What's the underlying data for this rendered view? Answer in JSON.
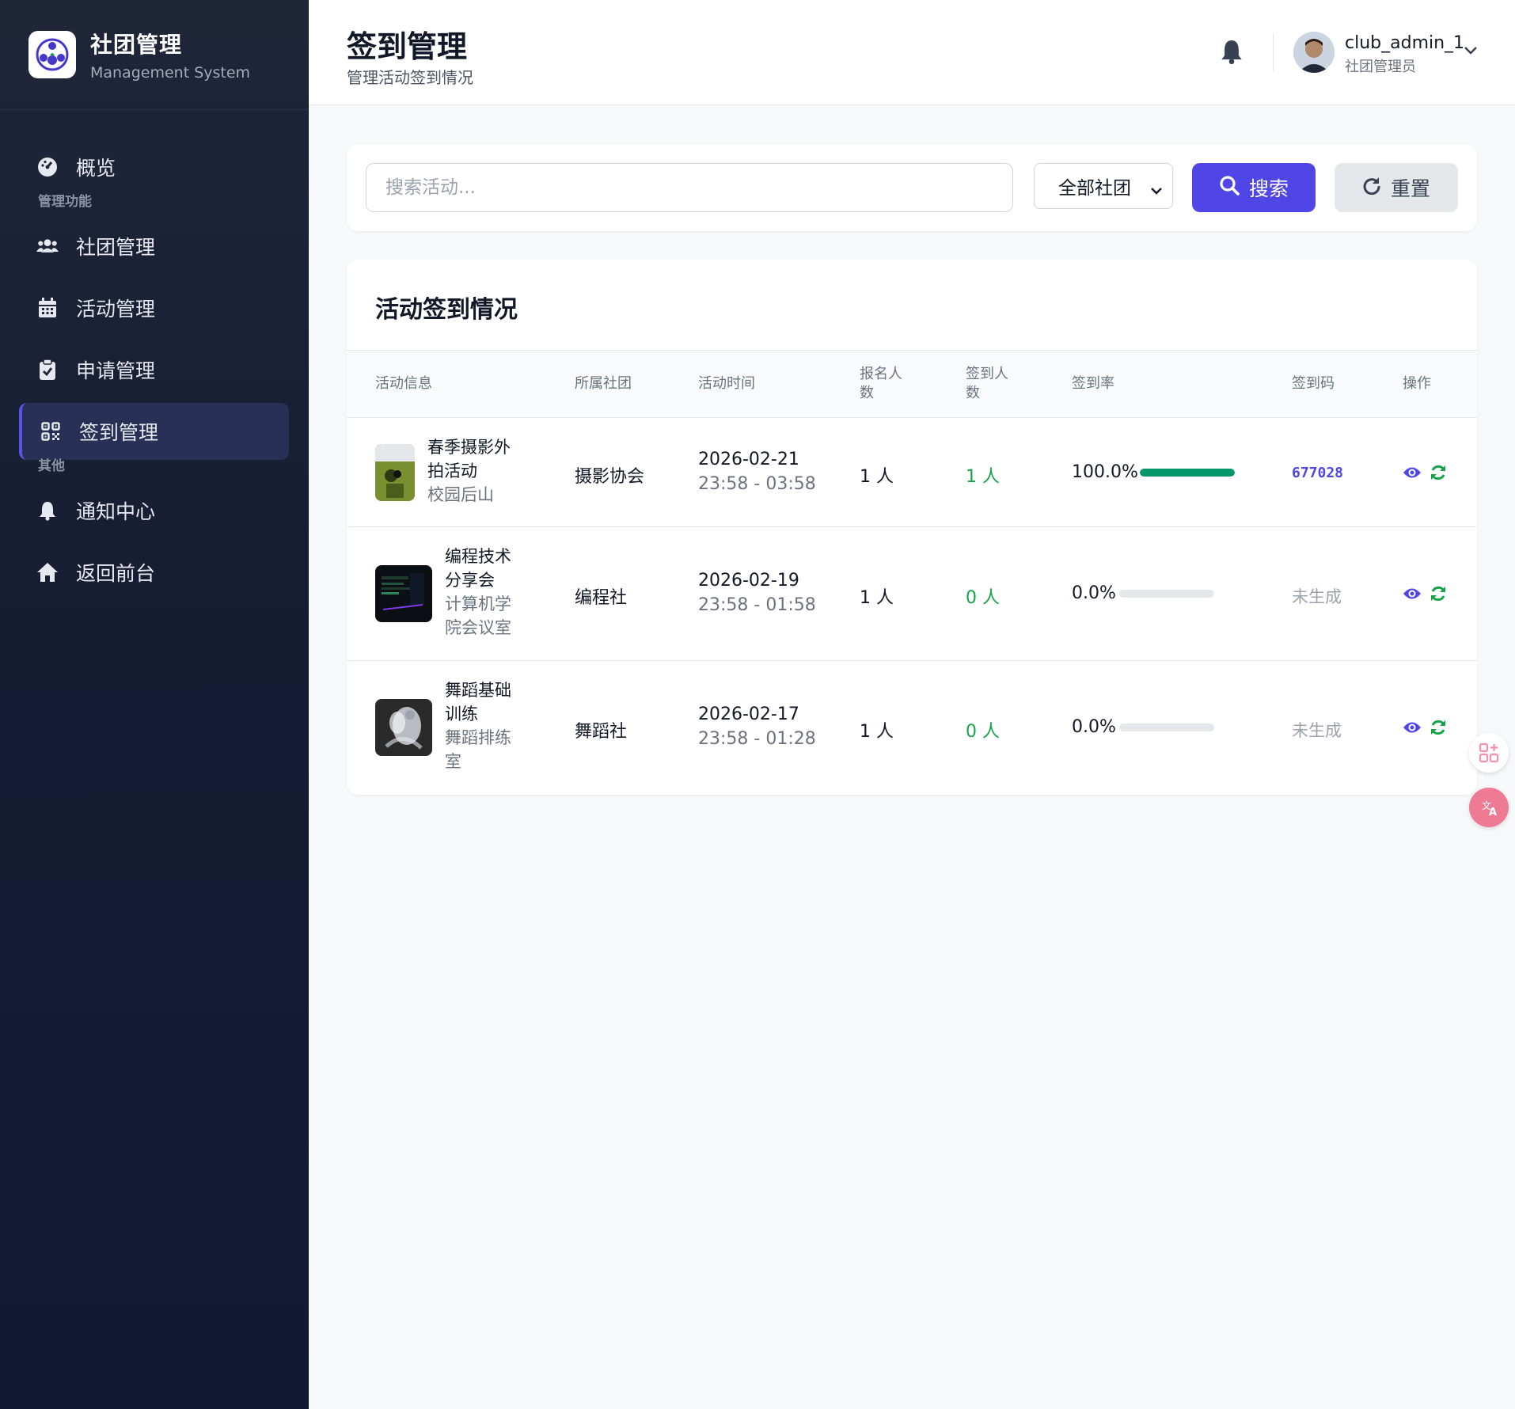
{
  "brand": {
    "title": "社团管理",
    "subtitle": "Management System"
  },
  "sidebar": {
    "overview": "概览",
    "section_manage": "管理功能",
    "items": [
      {
        "label": "社团管理",
        "icon": "users-icon"
      },
      {
        "label": "活动管理",
        "icon": "calendar-icon"
      },
      {
        "label": "申请管理",
        "icon": "clipboard-check-icon"
      },
      {
        "label": "签到管理",
        "icon": "qrcode-icon",
        "active": true
      }
    ],
    "section_other": "其他",
    "other_items": [
      {
        "label": "通知中心",
        "icon": "bell-icon"
      },
      {
        "label": "返回前台",
        "icon": "home-icon"
      }
    ]
  },
  "header": {
    "title": "签到管理",
    "subtitle": "管理活动签到情况",
    "user": {
      "name": "club_admin_1",
      "role": "社团管理员"
    }
  },
  "search": {
    "placeholder": "搜索活动...",
    "value": "",
    "club_filter": "全部社团",
    "search_label": "搜索",
    "reset_label": "重置"
  },
  "table": {
    "title": "活动签到情况",
    "columns": {
      "info": "活动信息",
      "club": "所属社团",
      "time": "活动时间",
      "registered_1": "报名人",
      "registered_2": "数",
      "checked_1": "签到人",
      "checked_2": "数",
      "rate": "签到率",
      "code": "签到码",
      "ops": "操作"
    },
    "rows": [
      {
        "name_lines": [
          "春季摄影外",
          "拍活动"
        ],
        "location_lines": [
          "校园后山"
        ],
        "club": "摄影协会",
        "date": "2026-02-21",
        "time_range": "23:58 - 03:58",
        "registered": "1 人",
        "checked_in": "1 人",
        "rate_text": "100.0%",
        "rate": 1.0,
        "code": "677028"
      },
      {
        "name_lines": [
          "编程技术",
          "分享会"
        ],
        "location_lines": [
          "计算机学",
          "院会议室"
        ],
        "club": "编程社",
        "date": "2026-02-19",
        "time_range": "23:58 - 01:58",
        "registered": "1 人",
        "checked_in": "0 人",
        "rate_text": "0.0%",
        "rate": 0.0,
        "code": "未生成"
      },
      {
        "name_lines": [
          "舞蹈基础",
          "训练"
        ],
        "location_lines": [
          "舞蹈排练",
          "室"
        ],
        "club": "舞蹈社",
        "date": "2026-02-17",
        "time_range": "23:58 - 01:28",
        "registered": "1 人",
        "checked_in": "0 人",
        "rate_text": "0.0%",
        "rate": 0.0,
        "code": "未生成"
      }
    ]
  },
  "colors": {
    "accent": "#4f46e5",
    "success": "#16a34a",
    "progress": "#059669",
    "sidebar": "#1e2638"
  }
}
